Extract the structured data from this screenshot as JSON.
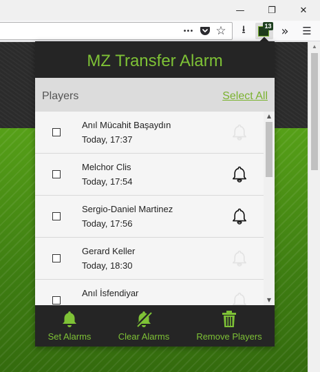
{
  "colors": {
    "accent": "#7ec236",
    "panel_dark": "#252525",
    "page_green": "#4a8c15"
  },
  "window": {
    "minimize_glyph": "—",
    "restore_glyph": "❐",
    "close_glyph": "✕"
  },
  "toolbar": {
    "icons": [
      "more-icon",
      "pocket-icon",
      "bookmark-star-icon",
      "download-icon",
      "extension-mz-icon",
      "overflow-icon",
      "menu-icon"
    ],
    "more_glyph": "•••",
    "star_glyph": "☆",
    "download_glyph": "⭳",
    "overflow_glyph": "»",
    "menu_glyph": "☰",
    "extension_badge": "13"
  },
  "popup": {
    "title": "MZ Transfer Alarm",
    "section_title": "Players",
    "select_all_label": "Select All",
    "players": [
      {
        "name": "Anıl Mücahit Başaydın",
        "time": "Today, 17:37",
        "alarm_active": false
      },
      {
        "name": "Melchor Clis",
        "time": "Today, 17:54",
        "alarm_active": true
      },
      {
        "name": "Sergio-Daniel Martinez",
        "time": "Today, 17:56",
        "alarm_active": true
      },
      {
        "name": "Gerard Keller",
        "time": "Today, 18:30",
        "alarm_active": false
      },
      {
        "name": "Anıl İsfendiyar",
        "time": "",
        "alarm_active": false
      }
    ],
    "footer": {
      "set_alarms_label": "Set Alarms",
      "clear_alarms_label": "Clear Alarms",
      "remove_players_label": "Remove Players"
    }
  }
}
